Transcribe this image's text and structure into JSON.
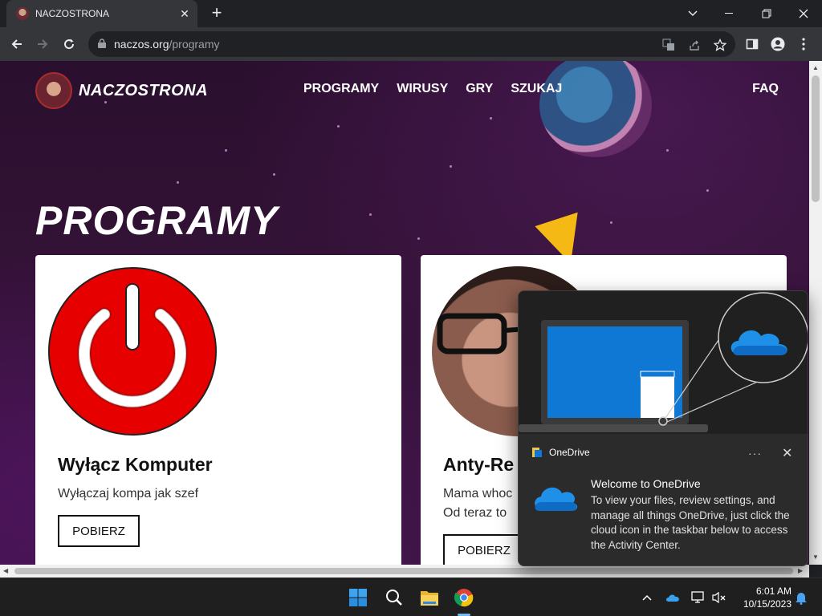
{
  "browser": {
    "tab_title": "NACZOSTRONA",
    "url_domain": "naczos.org",
    "url_path": "/programy"
  },
  "site": {
    "brand": "NACZOSTRONA",
    "nav": [
      "PROGRAMY",
      "WIRUSY",
      "GRY",
      "SZUKAJ"
    ],
    "faq": "FAQ",
    "page_title": "PROGRAMY",
    "cards": [
      {
        "title": "Wyłącz Komputer",
        "desc_lines": [
          "Wyłączaj kompa jak szef"
        ],
        "button": "POBIERZ"
      },
      {
        "title": "Anty-Re",
        "desc_lines": [
          "Mama whoc",
          "Od teraz to"
        ],
        "button": "POBIERZ"
      }
    ]
  },
  "onedrive": {
    "app_name": "OneDrive",
    "more": "···",
    "heading": "Welcome to OneDrive",
    "body": "To view your files, review settings, and manage all things OneDrive, just click the cloud icon in the taskbar below to access the Activity Center."
  },
  "taskbar": {
    "time": "6:01 AM",
    "date": "10/15/2023"
  },
  "colors": {
    "accent_blue": "#1a73e8",
    "power_red": "#e60000",
    "onedrive_blue": "#0f78d4"
  }
}
